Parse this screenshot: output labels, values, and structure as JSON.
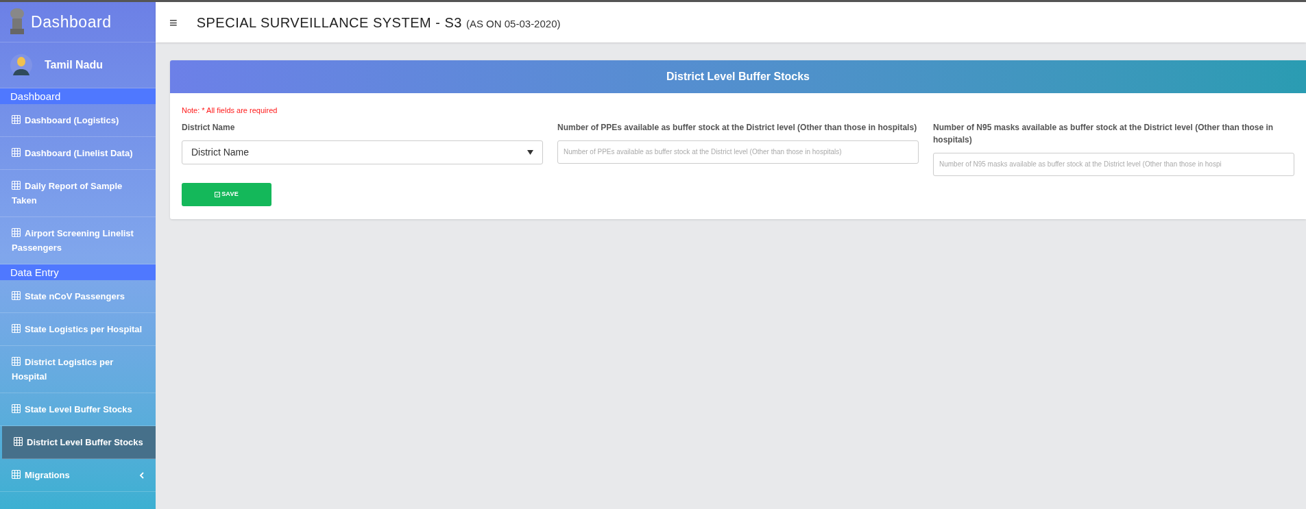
{
  "sidebar": {
    "brand": "Dashboard",
    "user": "Tamil Nadu",
    "sections": [
      {
        "title": "Dashboard",
        "items": [
          {
            "label": "Dashboard (Logistics)",
            "kind": "link",
            "selected": false
          },
          {
            "label": "Dashboard (Linelist Data)",
            "kind": "link",
            "selected": false
          },
          {
            "label": "Daily Report of Sample Taken",
            "kind": "link",
            "selected": false
          },
          {
            "label": "Airport Screening Linelist Passengers",
            "kind": "link",
            "selected": false
          }
        ]
      },
      {
        "title": "Data Entry",
        "items": [
          {
            "label": "State nCoV Passengers",
            "kind": "link",
            "selected": false
          },
          {
            "label": "State Logistics per Hospital",
            "kind": "link",
            "selected": false
          },
          {
            "label": "District Logistics per Hospital",
            "kind": "link",
            "selected": false
          },
          {
            "label": "State Level Buffer Stocks",
            "kind": "link",
            "selected": false
          },
          {
            "label": "District Level Buffer Stocks",
            "kind": "link",
            "selected": true
          },
          {
            "label": "Migrations",
            "kind": "submenu",
            "selected": false
          }
        ]
      }
    ]
  },
  "header": {
    "menu_icon": "≡",
    "title": "SPECIAL SURVEILLANCE SYSTEM - S3",
    "subtitle": "(AS ON 05-03-2020)"
  },
  "form": {
    "title": "District Level Buffer Stocks",
    "note": "Note: * All fields are required",
    "fields": [
      {
        "kind": "select",
        "label": "District Name",
        "value": "District Name"
      },
      {
        "kind": "text",
        "label": "Number of PPEs available as buffer stock at the District level (Other than those in hospitals)",
        "placeholder": "Number of PPEs available as buffer stock at the District level (Other than those in hospitals)"
      },
      {
        "kind": "text",
        "label": "Number of N95 masks available as buffer stock at the District level (Other than those in hospitals)",
        "placeholder": "Number of N95 masks available as buffer stock at the District level (Other than those in hospi"
      }
    ],
    "save": "SAVE"
  }
}
